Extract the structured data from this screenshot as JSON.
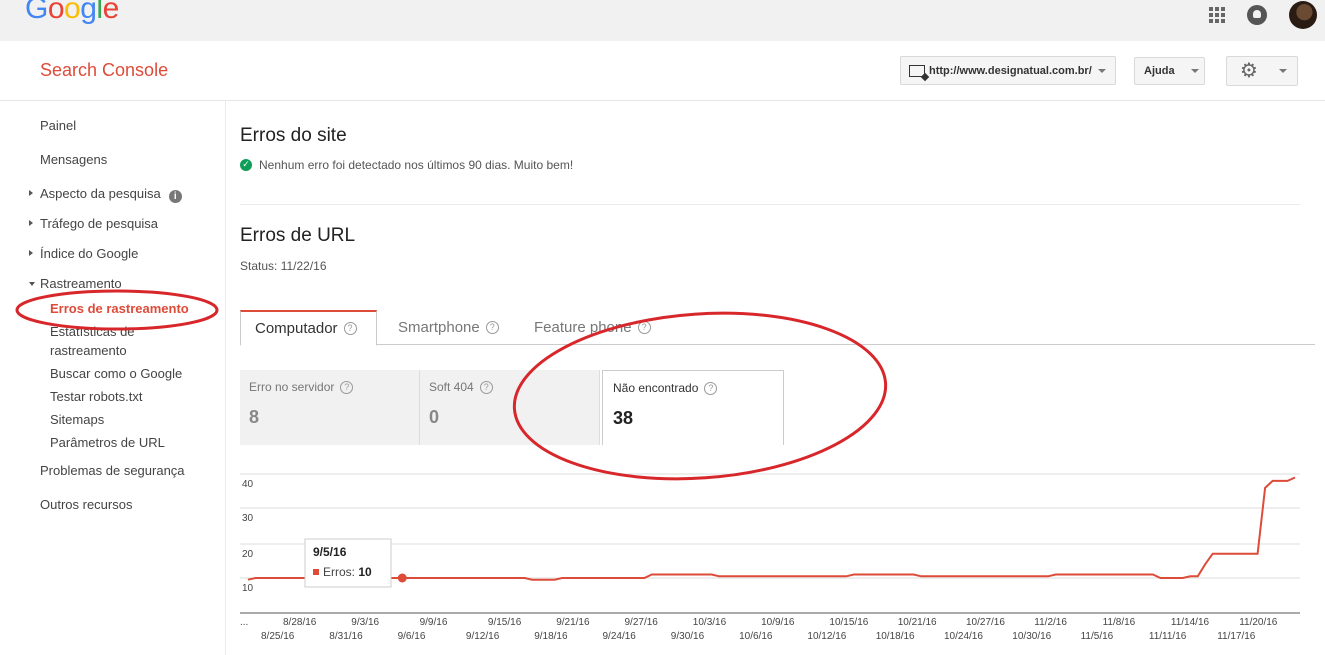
{
  "google_bar": {
    "logo": "Google",
    "logo_letters": [
      {
        "ch": "G",
        "color": "#4285f4"
      },
      {
        "ch": "o",
        "color": "#ea4335"
      },
      {
        "ch": "o",
        "color": "#fbbc05"
      },
      {
        "ch": "g",
        "color": "#4285f4"
      },
      {
        "ch": "l",
        "color": "#34a853"
      },
      {
        "ch": "e",
        "color": "#ea4335"
      }
    ]
  },
  "header": {
    "title": "Search Console",
    "site": "http://www.designatual.com.br/",
    "help": "Ajuda"
  },
  "sidebar": {
    "items": [
      {
        "label": "Painel"
      },
      {
        "label": "Mensagens"
      },
      {
        "label": "Aspecto da pesquisa"
      },
      {
        "label": "Tráfego de pesquisa"
      },
      {
        "label": "Índice do Google"
      },
      {
        "label": "Rastreamento"
      }
    ],
    "info": "i",
    "sub_items": [
      {
        "label": "Erros de rastreamento"
      },
      {
        "label": "Estatísticas de"
      },
      {
        "label": "rastreamento"
      },
      {
        "label": "Buscar como o Google"
      },
      {
        "label": "Testar robots.txt"
      },
      {
        "label": "Sitemaps"
      },
      {
        "label": "Parâmetros de URL"
      }
    ],
    "bottom_items": [
      {
        "label": "Problemas de segurança"
      },
      {
        "label": "Outros recursos"
      }
    ]
  },
  "main": {
    "site_errors_title": "Erros do site",
    "site_errors_ok": "Nenhum erro foi detectado nos últimos 90 dias. Muito bem!",
    "url_errors_title": "Erros de URL",
    "status": "Status: 11/22/16",
    "tabs": [
      {
        "label": "Computador"
      },
      {
        "label": "Smartphone"
      },
      {
        "label": "Feature phone"
      }
    ],
    "cards": [
      {
        "label": "Erro no servidor",
        "value": "8"
      },
      {
        "label": "Soft 404",
        "value": "0"
      },
      {
        "label": "Não encontrado",
        "value": "38"
      }
    ],
    "help_glyph": "?"
  },
  "chart_data": {
    "type": "line",
    "ylim": [
      0,
      40
    ],
    "yticks": [
      "40",
      "30",
      "20",
      "10"
    ],
    "xticks_top": [
      "...",
      "8/28/16",
      "9/3/16",
      "9/9/16",
      "9/15/16",
      "9/21/16",
      "9/27/16",
      "10/3/16",
      "10/9/16",
      "10/15/16",
      "10/21/16",
      "10/27/16",
      "11/2/16",
      "11/8/16",
      "11/14/16",
      "11/20/16"
    ],
    "xticks_bottom": [
      "8/25/16",
      "8/31/16",
      "9/6/16",
      "9/12/16",
      "9/18/16",
      "9/24/16",
      "9/30/16",
      "10/6/16",
      "10/12/16",
      "10/18/16",
      "10/24/16",
      "10/30/16",
      "11/5/16",
      "11/11/16",
      "11/17/16"
    ],
    "series": [
      {
        "color": "#dd4b39",
        "values": [
          9.5,
          10,
          10,
          10,
          10,
          10,
          10,
          10,
          10,
          10,
          10,
          10,
          10,
          10,
          10,
          10,
          10,
          10,
          10,
          10,
          10,
          10,
          10,
          10,
          10,
          10,
          10,
          10,
          10,
          10,
          10,
          10,
          10,
          10,
          10,
          10,
          10,
          10,
          9.5,
          9.5,
          9.5,
          9.5,
          10,
          10,
          10,
          10,
          10,
          10,
          10,
          10,
          10,
          10,
          10,
          10,
          11,
          11,
          11,
          11,
          11,
          11,
          11,
          11,
          11,
          10.5,
          10.5,
          10.5,
          10.5,
          10.5,
          10.5,
          10.5,
          10.5,
          10.5,
          10.5,
          10.5,
          10.5,
          10.5,
          10.5,
          10.5,
          10.5,
          10.5,
          10.5,
          11,
          11,
          11,
          11,
          11,
          11,
          11,
          11,
          11,
          10.5,
          10.5,
          10.5,
          10.5,
          10.5,
          10.5,
          10.5,
          10.5,
          10.5,
          10.5,
          10.5,
          10.5,
          10.5,
          10.5,
          10.5,
          10.5,
          10.5,
          10.5,
          11,
          11,
          11,
          11,
          11,
          11,
          11,
          11,
          11,
          11,
          11,
          11,
          11,
          11,
          10,
          10,
          10,
          10,
          10.5,
          10.5,
          14,
          17,
          17,
          17,
          17,
          17,
          17,
          17,
          36,
          38,
          38,
          38,
          39
        ]
      }
    ],
    "tooltip": {
      "date": "9/5/16",
      "series": "Erros",
      "value": "10",
      "index": 11
    }
  }
}
